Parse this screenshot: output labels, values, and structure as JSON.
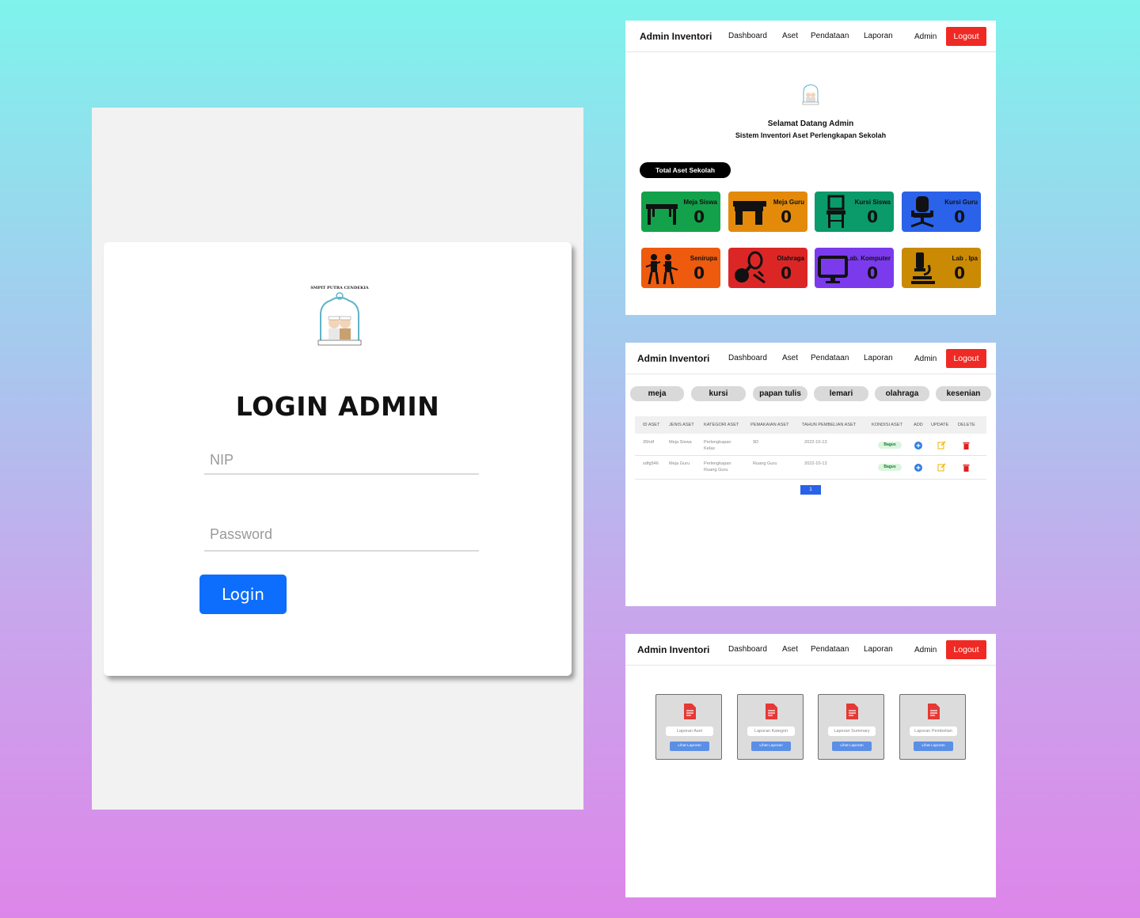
{
  "login": {
    "school_name": "SMPIT PUTRA CENDEKIA",
    "title": "LOGIN ADMIN",
    "nip_placeholder": "NIP",
    "password_placeholder": "Password",
    "login_label": "Login"
  },
  "navbar": {
    "brand": "Admin Inventori",
    "links": [
      "Dashboard",
      "Aset",
      "Pendataan",
      "Laporan"
    ],
    "user": "Admin",
    "logout": "Logout"
  },
  "dashboard": {
    "welcome": "Selamat Datang Admin",
    "subtitle": "Sistem Inventori Aset Perlengkapan Sekolah",
    "total_label": "Total Aset Sekolah",
    "cards": [
      {
        "label": "Meja Siswa",
        "count": "0",
        "color": "#13a24b",
        "icon": "table-icon"
      },
      {
        "label": "Meja Guru",
        "count": "0",
        "color": "#e38a0b",
        "icon": "desk-icon"
      },
      {
        "label": "Kursi Siswa",
        "count": "0",
        "color": "#0b9a6a",
        "icon": "chair-icon"
      },
      {
        "label": "Kursi Guru",
        "count": "0",
        "color": "#2a62ea",
        "icon": "office-chair-icon"
      },
      {
        "label": "Senirupa",
        "count": "0",
        "color": "#ee5a0e",
        "icon": "musicians-icon"
      },
      {
        "label": "Olahraga",
        "count": "0",
        "color": "#dc2626",
        "icon": "sports-icon"
      },
      {
        "label": "Lab. Komputer",
        "count": "0",
        "color": "#7c3aed",
        "icon": "computer-icon"
      },
      {
        "label": "Lab . Ipa",
        "count": "0",
        "color": "#ca8a04",
        "icon": "microscope-icon"
      }
    ]
  },
  "aset": {
    "categories": [
      "meja",
      "kursi",
      "papan tulis",
      "lemari",
      "olahraga",
      "kesenian"
    ],
    "columns": [
      "ID ASET",
      "JENIS ASET",
      "KATEGORI ASET",
      "PEMAKAIAN ASET",
      "TAHUN PEMBELIAN ASET",
      "KONDISI ASET",
      "ADD",
      "UPDATE",
      "DELETE"
    ],
    "rows": [
      {
        "id": "35hdf",
        "jenis": "Meja Siswa",
        "kategori_1": "Perlengkapan",
        "kategori_2": "Kelas",
        "pemakaian": "9D",
        "tahun": "2022-10-13",
        "kondisi": "Bagus"
      },
      {
        "id": "sdfg546",
        "jenis": "Meja Guru",
        "kategori_1": "Perlengkapan",
        "kategori_2": "Ruang Guru",
        "pemakaian": "Ruang Guru",
        "tahun": "2022-10-13",
        "kondisi": "Bagus"
      }
    ],
    "page": "1"
  },
  "laporan": {
    "reports": [
      {
        "name": "Laporan Aset",
        "button": "Lihat Laporan"
      },
      {
        "name": "Laporan Kategori",
        "button": "Lihat Laporan"
      },
      {
        "name": "Laporan Summary",
        "button": "Lihat Laporan"
      },
      {
        "name": "Laporan Pembelian",
        "button": "Lihat Laporan"
      }
    ]
  }
}
